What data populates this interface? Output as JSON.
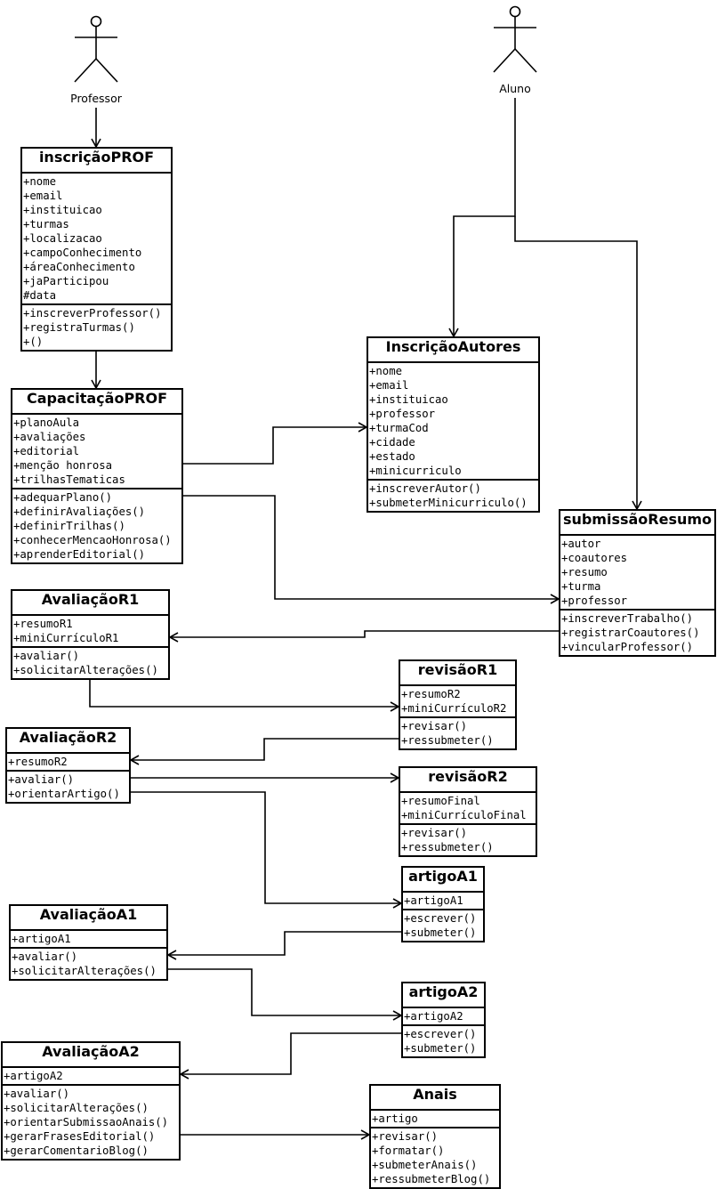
{
  "actors": [
    {
      "id": "professor",
      "label": "Professor"
    },
    {
      "id": "aluno",
      "label": "Aluno"
    }
  ],
  "classes": [
    {
      "id": "inscricaoProf",
      "name": "inscriçãoPROF",
      "attributes": [
        "+nome",
        "+email",
        "+instituicao",
        "+turmas",
        "+localizacao",
        "+campoConhecimento",
        "+áreaConhecimento",
        "+jaParticipou",
        "#data"
      ],
      "methods": [
        "+inscreverProfessor()",
        "+registraTurmas()",
        "+()"
      ]
    },
    {
      "id": "capacitacaoProf",
      "name": "CapacitaçãoPROF",
      "attributes": [
        "+planoAula",
        "+avaliações",
        "+editorial",
        "+menção honrosa",
        "+trilhasTematicas"
      ],
      "methods": [
        "+adequarPlano()",
        "+definirAvaliações()",
        "+definirTrilhas()",
        "+conhecerMencaoHonrosa()",
        "+aprenderEditorial()"
      ]
    },
    {
      "id": "inscricaoAutores",
      "name": "InscriçãoAutores",
      "attributes": [
        "+nome",
        "+email",
        "+instituicao",
        "+professor",
        "+turmaCod",
        "+cidade",
        "+estado",
        "+minicurriculo"
      ],
      "methods": [
        "+inscreverAutor()",
        "+submeterMinicurriculo()"
      ]
    },
    {
      "id": "submissaoResumo",
      "name": "submissãoResumo",
      "attributes": [
        "+autor",
        "+coautores",
        "+resumo",
        "+turma",
        "+professor"
      ],
      "methods": [
        "+inscreverTrabalho()",
        "+registrarCoautores()",
        "+vincularProfessor()"
      ]
    },
    {
      "id": "avaliacaoR1",
      "name": "AvaliaçãoR1",
      "attributes": [
        "+resumoR1",
        "+miniCurrículoR1"
      ],
      "methods": [
        "+avaliar()",
        "+solicitarAlterações()"
      ]
    },
    {
      "id": "revisaoR1",
      "name": "revisãoR1",
      "attributes": [
        "+resumoR2",
        "+miniCurrículoR2"
      ],
      "methods": [
        "+revisar()",
        "+ressubmeter()"
      ]
    },
    {
      "id": "avaliacaoR2",
      "name": "AvaliaçãoR2",
      "attributes": [
        "+resumoR2"
      ],
      "methods": [
        "+avaliar()",
        "+orientarArtigo()"
      ]
    },
    {
      "id": "revisaoR2",
      "name": "revisãoR2",
      "attributes": [
        "+resumoFinal",
        "+miniCurrículoFinal"
      ],
      "methods": [
        "+revisar()",
        "+ressubmeter()"
      ]
    },
    {
      "id": "artigoA1",
      "name": "artigoA1",
      "attributes": [
        "+artigoA1"
      ],
      "methods": [
        "+escrever()",
        "+submeter()"
      ]
    },
    {
      "id": "avaliacaoA1",
      "name": "AvaliaçãoA1",
      "attributes": [
        "+artigoA1"
      ],
      "methods": [
        "+avaliar()",
        "+solicitarAlterações()"
      ]
    },
    {
      "id": "artigoA2",
      "name": "artigoA2",
      "attributes": [
        "+artigoA2"
      ],
      "methods": [
        "+escrever()",
        "+submeter()"
      ]
    },
    {
      "id": "avaliacaoA2",
      "name": "AvaliaçãoA2",
      "attributes": [
        "+artigoA2"
      ],
      "methods": [
        "+avaliar()",
        "+solicitarAlterações()",
        "+orientarSubmissaoAnais()",
        "+gerarFrasesEditorial()",
        "+gerarComentarioBlog()"
      ]
    },
    {
      "id": "anais",
      "name": "Anais",
      "attributes": [
        "+artigo"
      ],
      "methods": [
        "+revisar()",
        "+formatar()",
        "+submeterAnais()",
        "+ressubmeterBlog()"
      ]
    }
  ],
  "associations": [
    {
      "from": "professor",
      "to": "inscricaoProf"
    },
    {
      "from": "inscricaoProf",
      "to": "capacitacaoProf"
    },
    {
      "from": "aluno",
      "to": "inscricaoAutores"
    },
    {
      "from": "aluno",
      "to": "submissaoResumo"
    },
    {
      "from": "capacitacaoProf",
      "to": "inscricaoAutores"
    },
    {
      "from": "capacitacaoProf",
      "to": "submissaoResumo"
    },
    {
      "from": "submissaoResumo",
      "to": "avaliacaoR1"
    },
    {
      "from": "avaliacaoR1",
      "to": "revisaoR1"
    },
    {
      "from": "revisaoR1",
      "to": "avaliacaoR2"
    },
    {
      "from": "avaliacaoR2",
      "to": "revisaoR2"
    },
    {
      "from": "avaliacaoR2",
      "to": "artigoA1"
    },
    {
      "from": "artigoA1",
      "to": "avaliacaoA1"
    },
    {
      "from": "avaliacaoA1",
      "to": "artigoA2"
    },
    {
      "from": "artigoA2",
      "to": "avaliacaoA2"
    },
    {
      "from": "avaliacaoA2",
      "to": "anais"
    }
  ]
}
